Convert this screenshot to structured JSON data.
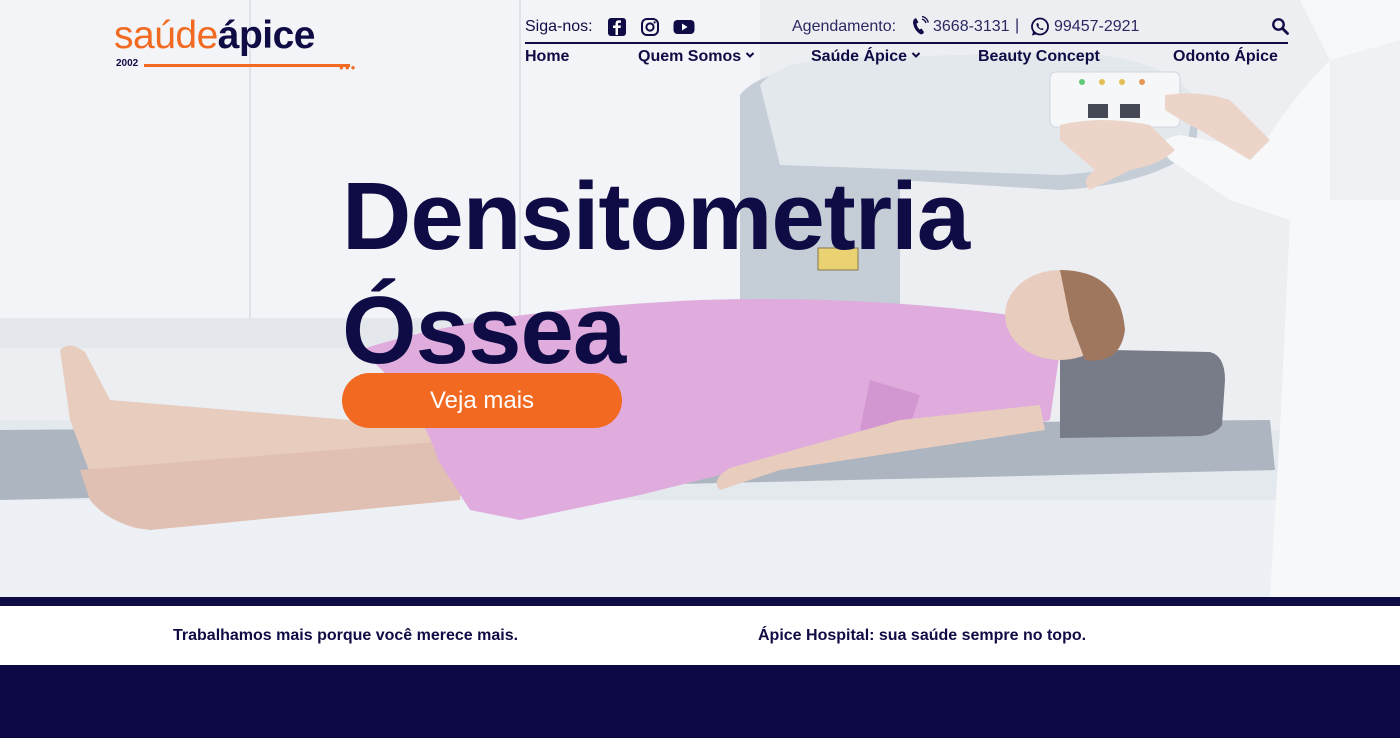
{
  "brand": {
    "name_part1": "saúde",
    "name_part2": "ápice",
    "year": "2002"
  },
  "colors": {
    "navy": "#0f0c45",
    "orange": "#f26a21",
    "gown": "#d89ad6"
  },
  "topbar": {
    "follow_label": "Siga-nos:",
    "social_icons": [
      "facebook-icon",
      "instagram-icon",
      "youtube-icon"
    ],
    "schedule_label": "Agendamento:",
    "phone": "3668-3131",
    "separator": "|",
    "whatsapp": "99457-2921"
  },
  "nav": {
    "items": [
      {
        "label": "Home",
        "has_dropdown": false
      },
      {
        "label": "Quem Somos",
        "has_dropdown": true
      },
      {
        "label": "Saúde Ápice",
        "has_dropdown": true
      },
      {
        "label": "Beauty Concept",
        "has_dropdown": false
      },
      {
        "label": "Odonto Ápice",
        "has_dropdown": false
      }
    ]
  },
  "hero": {
    "title_line1": "Densitometria",
    "title_line2": "Óssea",
    "cta_label": "Veja mais"
  },
  "taglines": [
    "Trabalhamos mais porque você merece mais.",
    "Ápice Hospital: sua saúde sempre no topo."
  ]
}
